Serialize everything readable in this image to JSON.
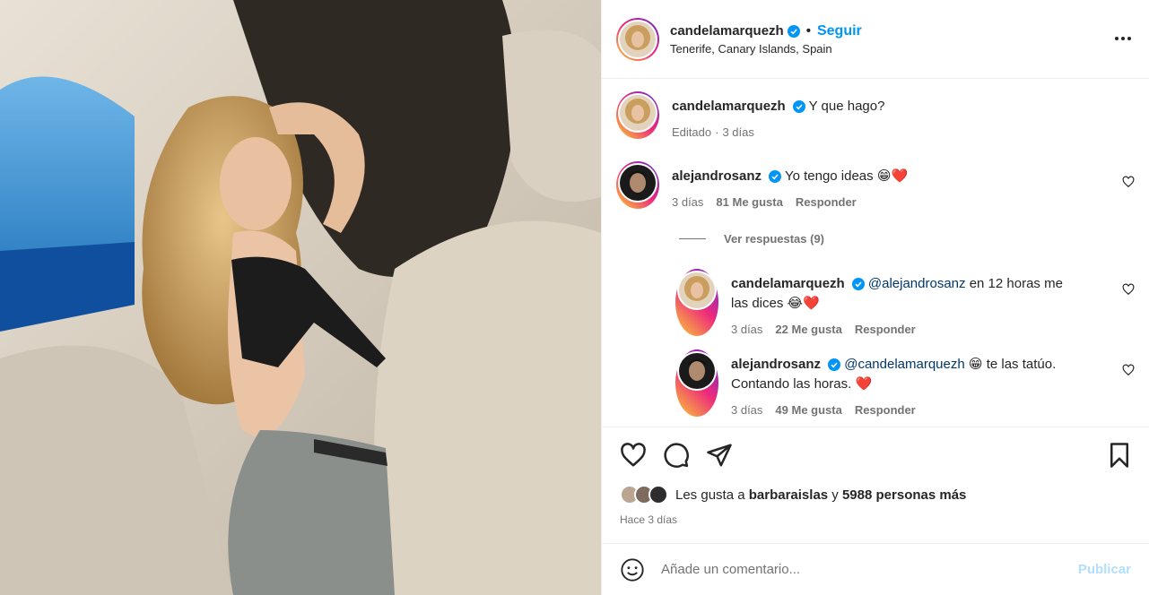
{
  "post": {
    "username": "candelamarquezh",
    "follow_label": "Seguir",
    "separator": "•",
    "location": "Tenerife, Canary Islands, Spain",
    "more_icon": "more-horizontal-icon"
  },
  "caption": {
    "username": "candelamarquezh",
    "text": "Y que hago?",
    "meta_edited": "Editado",
    "meta_sep": "·",
    "meta_time": "3 días"
  },
  "comments": [
    {
      "username": "alejandrosanz",
      "text": "Yo tengo ideas",
      "emoji1": "😁",
      "emoji2": "❤️",
      "time": "3 días",
      "likes": "81 Me gusta",
      "reply": "Responder"
    }
  ],
  "view_replies": "Ver respuestas (9)",
  "replies": [
    {
      "username": "candelamarquezh",
      "mention": "@alejandrosanz",
      "text1": "en 12 horas me",
      "text2": "las dices",
      "emoji1": "😂",
      "emoji2": "❤️",
      "time": "3 días",
      "likes": "22 Me gusta",
      "reply": "Responder"
    },
    {
      "username": "alejandrosanz",
      "mention": "@candelamarquezh",
      "emoji1": "😁",
      "text1": "te las tatúo.",
      "text2": "Contando las horas.",
      "emoji2": "❤️",
      "time": "3 días",
      "likes": "49 Me gusta",
      "reply": "Responder"
    }
  ],
  "likes_summary": {
    "prefix": "Les gusta a",
    "user": "barbaraislas",
    "conj": "y",
    "others": "5988 personas más"
  },
  "posted_time": "Hace 3 días",
  "add_comment": {
    "placeholder": "Añade un comentario...",
    "publish": "Publicar"
  },
  "colors": {
    "accent": "#0095f6",
    "mention": "#00376b",
    "secondary_text": "#737373",
    "publish_disabled": "#b2dffc",
    "heart_red": "#ed4956"
  }
}
